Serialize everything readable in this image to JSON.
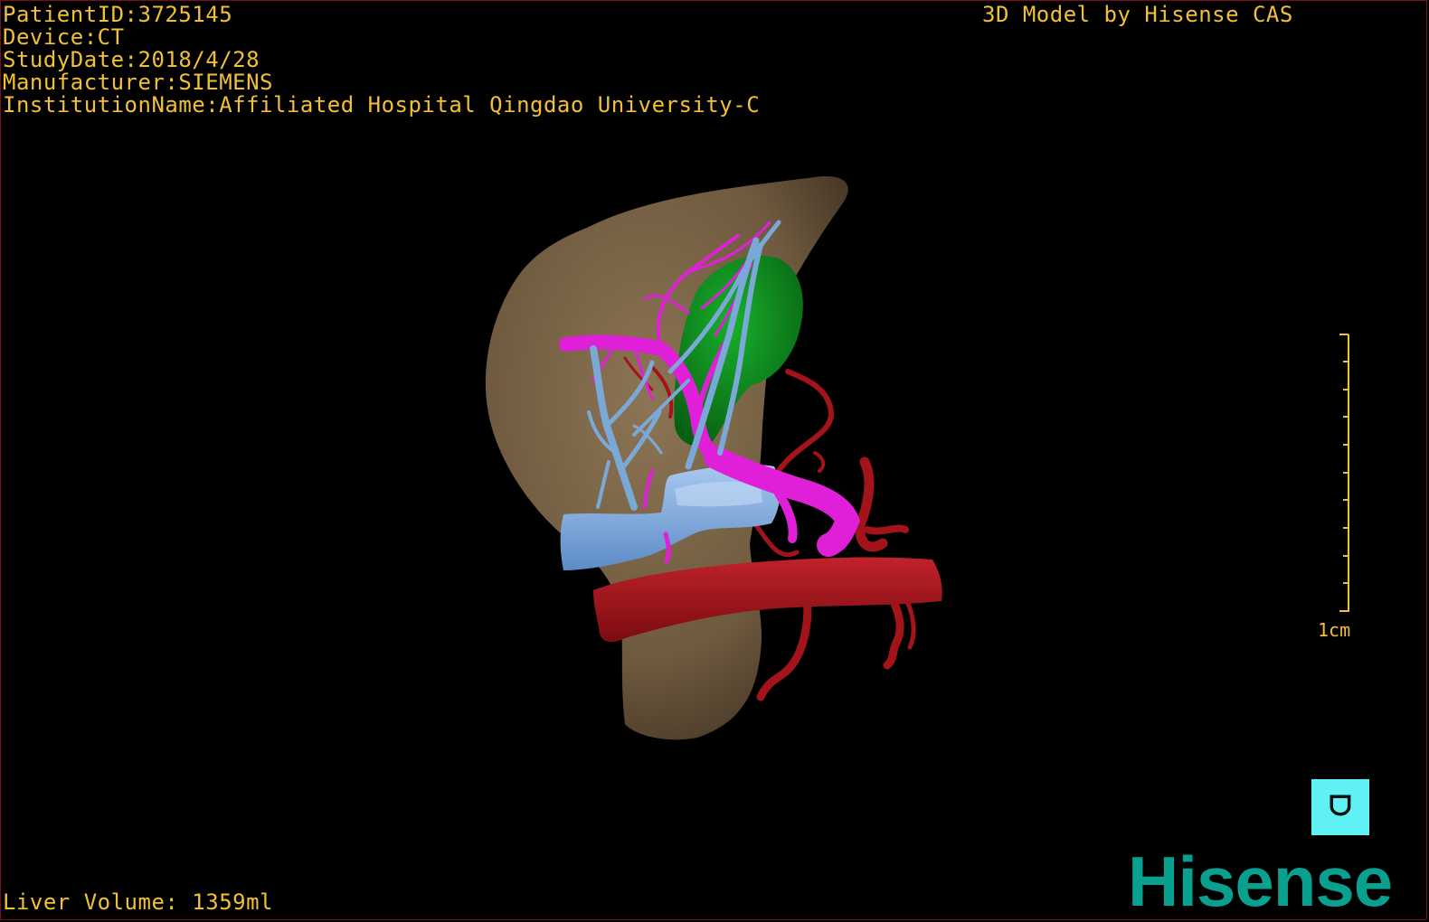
{
  "patient_info": {
    "patient_id": "PatientID:3725145",
    "device": "Device:CT",
    "study_date": "StudyDate:2018/4/28",
    "manufacturer": "Manufacturer:SIEMENS",
    "institution": "InstitutionName:Affiliated Hospital Qingdao University-C"
  },
  "model_credit": "3D Model by Hisense CAS",
  "liver_volume": "Liver Volume: 1359ml",
  "scale": {
    "label": "1cm"
  },
  "orientation_cube": {
    "glyph": "ᗜ",
    "icon": "orientation-cube-icon"
  },
  "brand": "Hisense",
  "colors": {
    "overlay_text": "#f2c037",
    "liver": "#7b6447",
    "portal_vein": "#e020d8",
    "hepatic_vein": "#7aa9d8",
    "artery": "#a3141a",
    "gallbladder": "#0d8a1f",
    "brand": "#0aa08f",
    "cube": "#5ff1f3"
  }
}
